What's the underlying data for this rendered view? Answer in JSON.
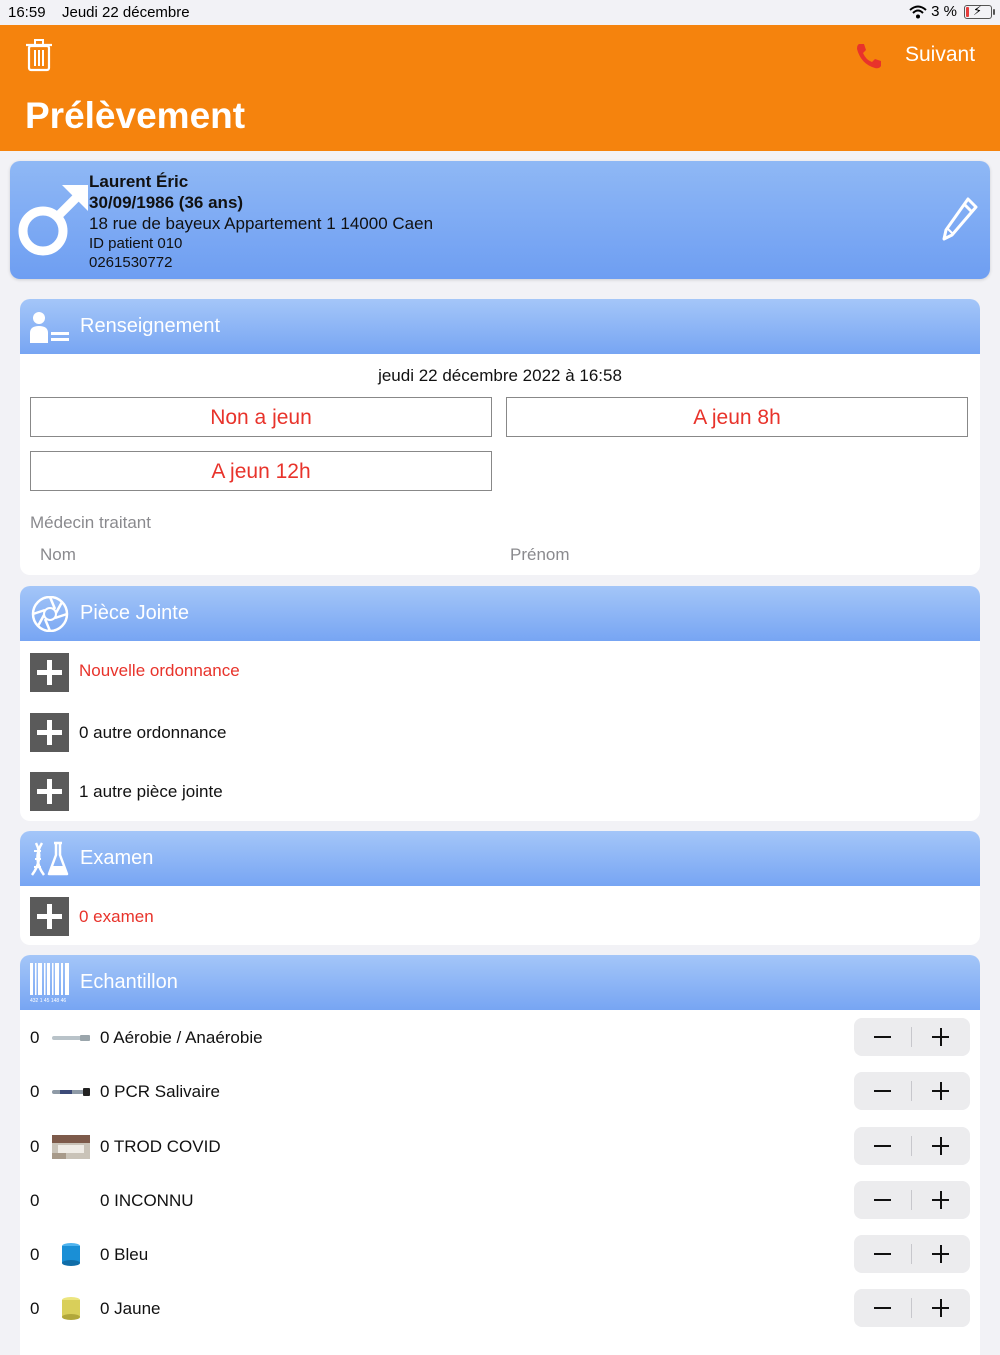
{
  "status_bar": {
    "time": "16:59",
    "date": "Jeudi 22 décembre",
    "battery": "3 %"
  },
  "header": {
    "title": "Prélèvement",
    "next_label": "Suivant"
  },
  "patient": {
    "name": "Laurent Éric",
    "dob": "30/09/1986 (36 ans)",
    "address": "18 rue de bayeux Appartement 1 14000 Caen",
    "patient_id": "ID patient 010",
    "phone": "0261530772"
  },
  "renseignement": {
    "title": "Renseignement",
    "datetime": "jeudi 22 décembre 2022 à 16:58",
    "fasting_options": [
      "Non a jeun",
      "A jeun 8h",
      "A jeun 12h"
    ],
    "doctor_label": "Médecin traitant",
    "last_name_placeholder": "Nom",
    "first_name_placeholder": "Prénom"
  },
  "piece_jointe": {
    "title": "Pièce Jointe",
    "items": [
      "Nouvelle ordonnance",
      "0 autre ordonnance",
      "1 autre pièce jointe"
    ]
  },
  "examen": {
    "title": "Examen",
    "item": "0 examen"
  },
  "echantillon": {
    "title": "Echantillon",
    "barcode_text": "432 1 45 148 46",
    "samples": [
      {
        "count": "0",
        "label": "0 Aérobie / Anaérobie",
        "tube": "swab-tube"
      },
      {
        "count": "0",
        "label": "0 PCR Salivaire",
        "tube": "pcr-tube"
      },
      {
        "count": "0",
        "label": "0 TROD COVID",
        "tube": "trod-photo"
      },
      {
        "count": "0",
        "label": "0 INCONNU",
        "tube": "none"
      },
      {
        "count": "0",
        "label": "0 Bleu",
        "tube": "blue-cap",
        "color": "#1a8fd6"
      },
      {
        "count": "0",
        "label": "0 Jaune",
        "tube": "yellow-cap",
        "color": "#d9cf5a"
      }
    ]
  },
  "colors": {
    "header": "#f5830d",
    "accent_red": "#e8332b",
    "section_blue": "#77a5f3"
  }
}
